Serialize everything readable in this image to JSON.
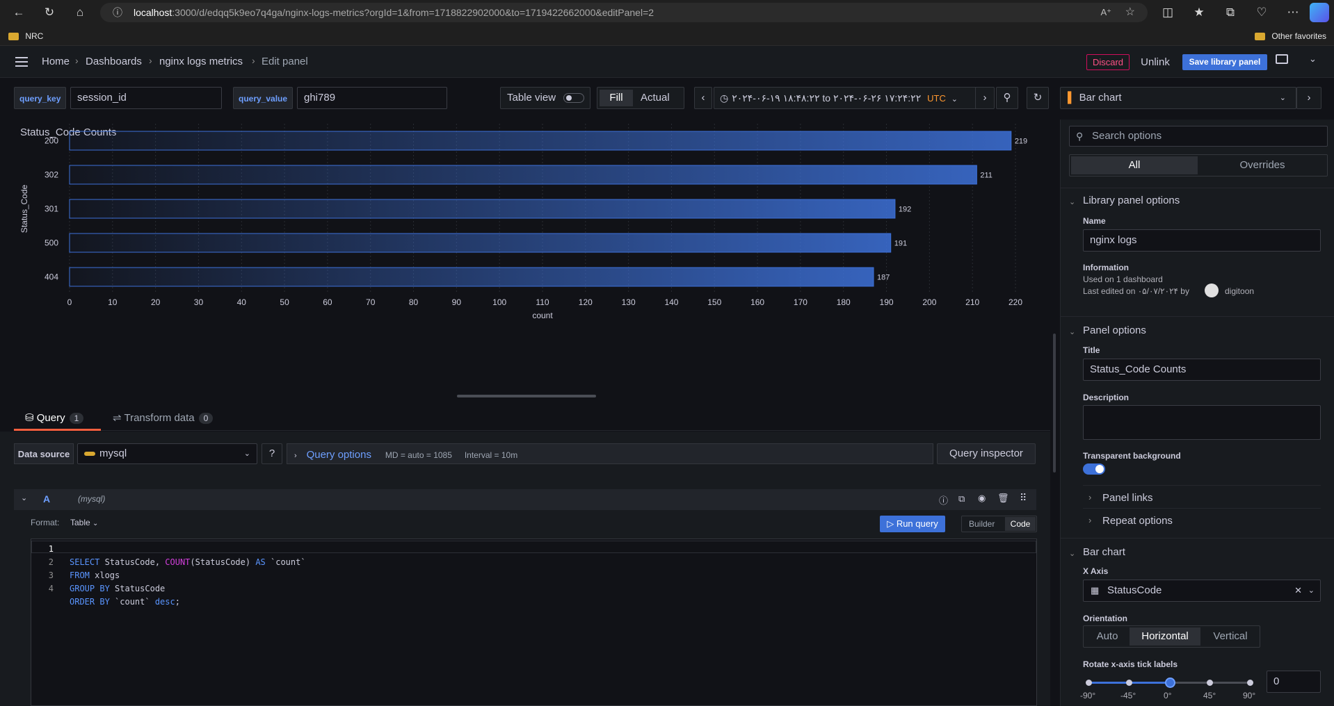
{
  "browser": {
    "url_host": "localhost",
    "url_rest": ":3000/d/edqq5k9eo7q4ga/nginx-logs-metrics?orgId=1&from=1718822902000&to=1719422662000&editPanel=2",
    "favorites_folder": "NRC",
    "other_favorites": "Other favorites"
  },
  "topnav": {
    "breadcrumbs": [
      "Home",
      "Dashboards",
      "nginx logs metrics",
      "Edit panel"
    ],
    "discard": "Discard",
    "unlink": "Unlink",
    "save": "Save library panel"
  },
  "vars": [
    {
      "key": "query_key",
      "value": "session_id"
    },
    {
      "key": "query_value",
      "value": "ghi789"
    }
  ],
  "toolbar": {
    "table_view": "Table view",
    "fill": "Fill",
    "actual": "Actual",
    "time_range": "۲۰۲۴-۰۶-۱۹ ۱۸:۴۸:۲۲ to ۲۰۲۴-۰۶-۲۶ ۱۷:۲۴:۲۲",
    "timezone": "UTC",
    "viz": "Bar chart"
  },
  "chart_data": {
    "type": "bar",
    "orientation": "horizontal",
    "title": "Status_Code Counts",
    "categories": [
      "200",
      "302",
      "301",
      "500",
      "404"
    ],
    "values": [
      219,
      211,
      192,
      191,
      187
    ],
    "xlabel": "count",
    "ylabel": "Status_Code",
    "xlim": [
      0,
      220
    ],
    "xticks": [
      0,
      10,
      20,
      30,
      40,
      50,
      60,
      70,
      80,
      90,
      100,
      110,
      120,
      130,
      140,
      150,
      160,
      170,
      180,
      190,
      200,
      210,
      220
    ],
    "grid": true,
    "bar_color": "#3d71d9"
  },
  "query": {
    "tabs": [
      {
        "label": "Query",
        "count": "1"
      },
      {
        "label": "Transform data",
        "count": "0"
      }
    ],
    "datasource_label": "Data source",
    "datasource": "mysql",
    "options_label": "Query options",
    "md": "MD = auto = 1085",
    "interval": "Interval = 10m",
    "inspector": "Query inspector",
    "ref_id": "A",
    "ref_ds": "(mysql)",
    "format_label": "Format:",
    "format_value": "Table",
    "run": "Run query",
    "builder": "Builder",
    "code": "Code",
    "line_numbers": [
      "1",
      "2",
      "3",
      "4"
    ]
  },
  "options": {
    "search_placeholder": "Search options",
    "tab_all": "All",
    "tab_overrides": "Overrides",
    "library_section": "Library panel options",
    "name_label": "Name",
    "name_value": "nginx logs",
    "info_label": "Information",
    "info_used": "Used on 1 dashboard",
    "info_edited": "Last edited on ۰۵/۰۷/۲۰۲۴ by",
    "info_user": "digitoon",
    "panel_section": "Panel options",
    "title_label": "Title",
    "title_value": "Status_Code Counts",
    "desc_label": "Description",
    "transparent_label": "Transparent background",
    "panel_links": "Panel links",
    "repeat_options": "Repeat options",
    "bar_section": "Bar chart",
    "xaxis_label": "X Axis",
    "xaxis_value": "StatusCode",
    "orientation_label": "Orientation",
    "orientation_options": [
      "Auto",
      "Horizontal",
      "Vertical"
    ],
    "rotate_label": "Rotate x-axis tick labels",
    "rotate_marks": [
      "-90°",
      "-45°",
      "0°",
      "45°",
      "90°"
    ],
    "rotate_value": "0"
  }
}
